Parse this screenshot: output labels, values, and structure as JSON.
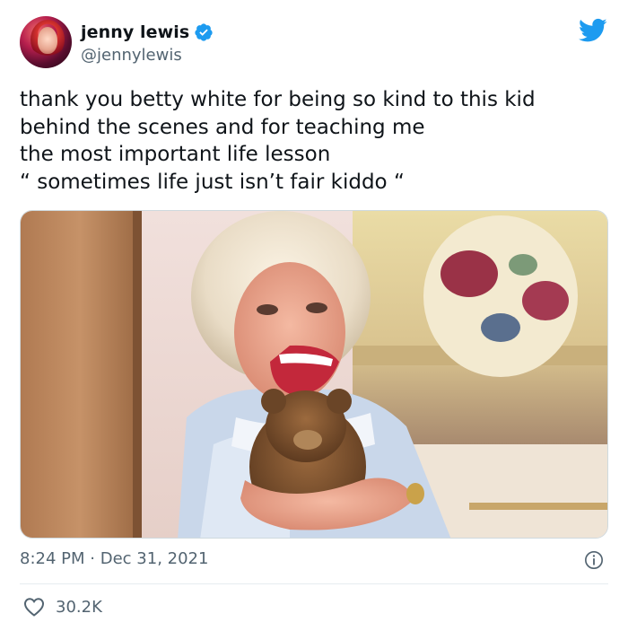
{
  "author": {
    "display_name": "jenny lewis",
    "handle": "@jennylewis",
    "verified_icon": "verified-badge-icon",
    "avatar_icon": "profile-avatar"
  },
  "platform_icon": "twitter-bird-icon",
  "tweet": {
    "text": "thank you betty white for being so kind to this kid\nbehind the scenes and for teaching me\nthe most important life lesson\n“ sometimes life just isn’t fair kiddo “",
    "media_description_icon": "photo-woman-laughing-hugging-teddy-bear",
    "time": "8:24 PM",
    "separator": "·",
    "date": "Dec 31, 2021",
    "info_icon": "info-icon"
  },
  "engagement": {
    "like_icon": "heart-icon",
    "like_count": "30.2K"
  },
  "colors": {
    "brand_blue": "#1d9bf0",
    "text_primary": "#0f1419",
    "text_secondary": "#536471",
    "divider": "#e6ecf0"
  }
}
